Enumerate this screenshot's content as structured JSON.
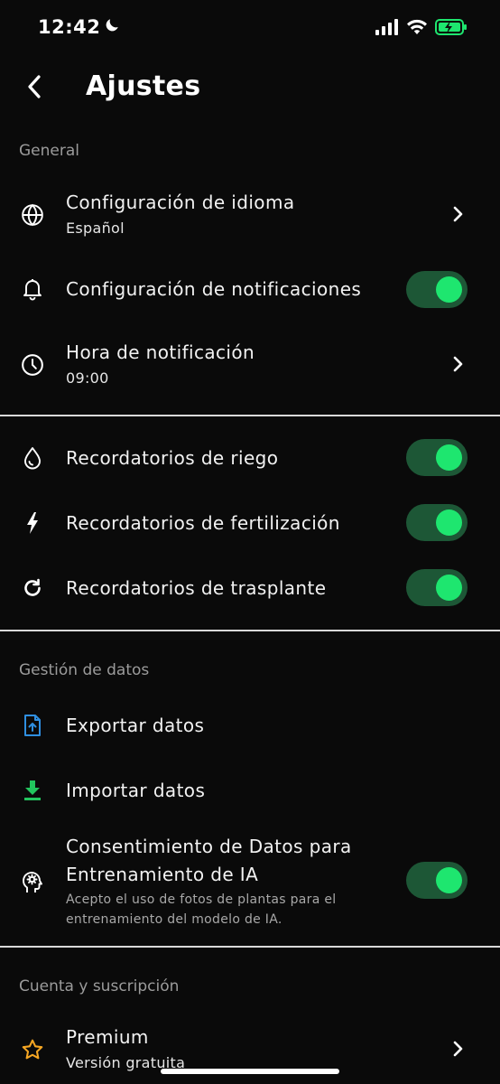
{
  "status_bar": {
    "time": "12:42"
  },
  "header": {
    "title": "Ajustes"
  },
  "sections": {
    "general": "General",
    "data": "Gestión de datos",
    "account": "Cuenta y suscripción"
  },
  "items": {
    "language": {
      "label": "Configuración de idioma",
      "value": "Español"
    },
    "notifications": {
      "label": "Configuración de notificaciones",
      "enabled": true
    },
    "notif_time": {
      "label": "Hora de notificación",
      "value": "09:00"
    },
    "watering": {
      "label": "Recordatorios de riego",
      "enabled": true
    },
    "fertilization": {
      "label": "Recordatorios de fertilización",
      "enabled": true
    },
    "transplant": {
      "label": "Recordatorios de trasplante",
      "enabled": true
    },
    "export": {
      "label": "Exportar datos"
    },
    "import": {
      "label": "Importar datos"
    },
    "ai_consent": {
      "label_line1": "Consentimiento de Datos para",
      "label_line2": "Entrenamiento de IA",
      "desc_line1": "Acepto el uso de fotos de plantas para el",
      "desc_line2": "entrenamiento del modelo de IA.",
      "enabled": true
    },
    "premium": {
      "label": "Premium",
      "value": "Versión gratuita"
    }
  },
  "colors": {
    "background": "#0a0a0a",
    "toggle_track": "#1d5736",
    "toggle_knob": "#1ee66f",
    "export_icon": "#2f8fe0",
    "import_icon": "#22c55e",
    "premium_icon": "#f5a623",
    "battery": "#1ee66f"
  }
}
